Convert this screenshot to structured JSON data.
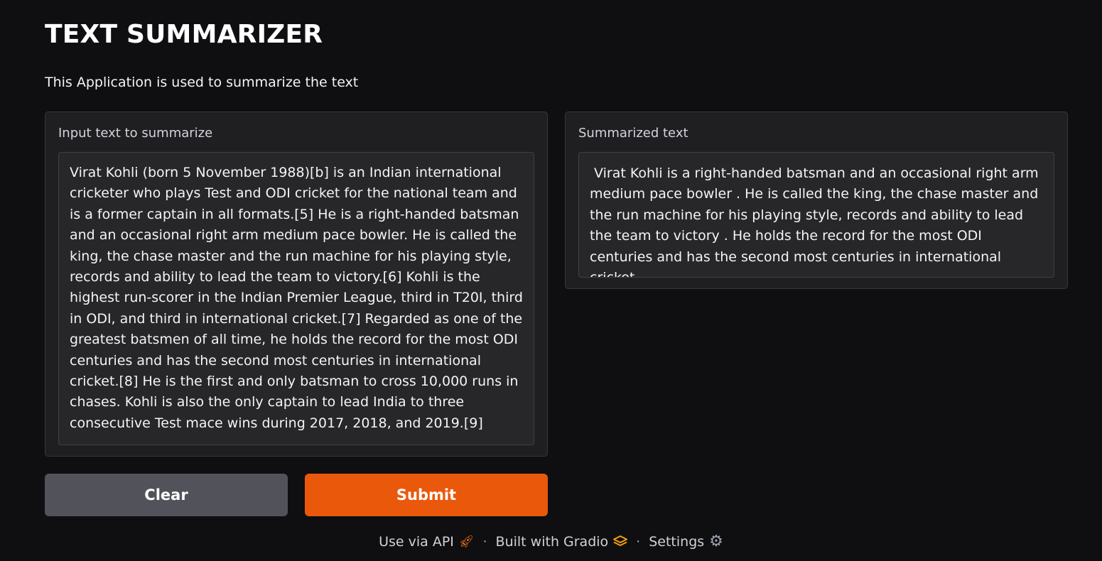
{
  "header": {
    "title": "TEXT SUMMARIZER",
    "description": "This Application is used to summarize the text"
  },
  "input_panel": {
    "label": "Input text to summarize",
    "value": "Virat Kohli (born 5 November 1988)[b] is an Indian international cricketer who plays Test and ODI cricket for the national team and is a former captain in all formats.[5] He is a right-handed batsman and an occasional right arm medium pace bowler. He is called the king, the chase master and the run machine for his playing style, records and ability to lead the team to victory.[6] Kohli is the highest run-scorer in the Indian Premier League, third in T20I, third in ODI, and third in international cricket.[7] Regarded as one of the greatest batsmen of all time, he holds the record for the most ODI centuries and has the second most centuries in international cricket.[8] He is the first and only batsman to cross 10,000 runs in chases. Kohli is also the only captain to lead India to three consecutive Test mace wins during 2017, 2018, and 2019.[9]"
  },
  "output_panel": {
    "label": "Summarized text",
    "value": " Virat Kohli is a right-handed batsman and an occasional right arm medium pace bowler . He is called the king, the chase master and the run machine for his playing style, records and ability to lead the team to victory . He holds the record for the most ODI centuries and has the second most centuries in international cricket ."
  },
  "buttons": {
    "clear_label": "Clear",
    "submit_label": "Submit"
  },
  "footer": {
    "api_label": "Use via API",
    "api_icon": "rocket-icon",
    "built_label": "Built with Gradio",
    "built_icon": "gradio-logo-icon",
    "settings_label": "Settings",
    "settings_icon": "gear-icon",
    "separator": "·"
  },
  "colors": {
    "background": "#0f0f11",
    "panel": "#1f1f22",
    "submit": "#ea580c",
    "clear": "#52525b",
    "gradio_logo": "#f59e0b"
  }
}
